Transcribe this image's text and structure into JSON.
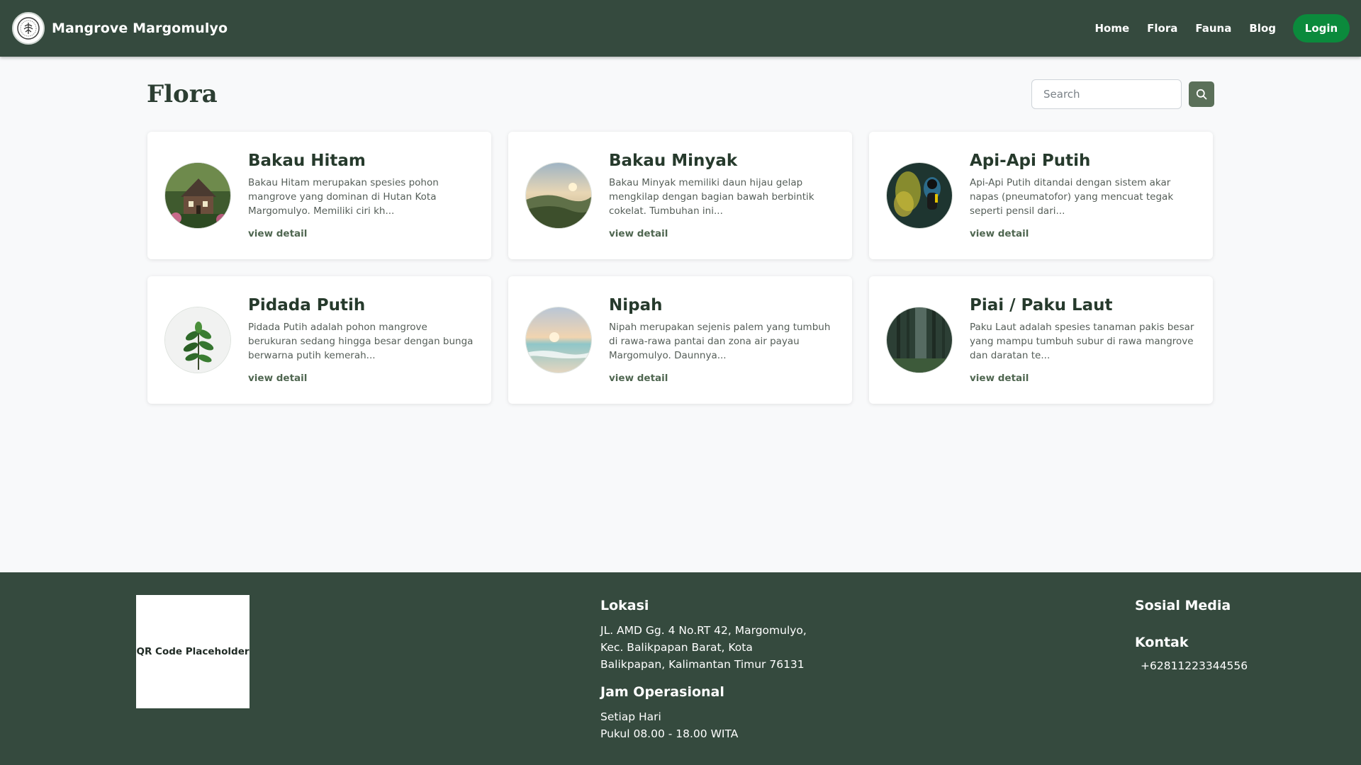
{
  "navbar": {
    "brand": "Mangrove Margomulyo",
    "links": [
      "Home",
      "Flora",
      "Fauna",
      "Blog"
    ],
    "login_label": "Login"
  },
  "page": {
    "title": "Flora",
    "search_placeholder": "Search"
  },
  "cards": [
    {
      "title": "Bakau Hitam",
      "description": "Bakau Hitam merupakan spesies pohon mangrove yang dominan di Hutan Kota Margomulyo. Memiliki ciri kh...",
      "link": "view detail",
      "image": "house-photo"
    },
    {
      "title": "Bakau Minyak",
      "description": "Bakau Minyak memiliki daun hijau gelap mengkilap dengan bagian bawah berbintik cokelat. Tumbuhan ini...",
      "link": "view detail",
      "image": "hills-photo"
    },
    {
      "title": "Api-Api Putih",
      "description": "Api-Api Putih ditandai dengan sistem akar napas (pneumatofor) yang mencuat tegak seperti pensil dari...",
      "link": "view detail",
      "image": "diver-photo"
    },
    {
      "title": "Pidada Putih",
      "description": "Pidada Putih adalah pohon mangrove berukuran sedang hingga besar dengan bunga berwarna putih kemerah...",
      "link": "view detail",
      "image": "plant-photo"
    },
    {
      "title": "Nipah",
      "description": "Nipah merupakan sejenis palem yang tumbuh di rawa-rawa pantai dan zona air payau Margomulyo. Daunnya...",
      "link": "view detail",
      "image": "beach-photo"
    },
    {
      "title": "Piai / Paku Laut",
      "description": "Paku Laut adalah spesies tanaman pakis besar yang mampu tumbuh subur di rawa mangrove dan daratan te...",
      "link": "view detail",
      "image": "forest-photo"
    }
  ],
  "footer": {
    "qr_label": "QR Code Placeholder",
    "lokasi_title": "Lokasi",
    "lokasi_lines": [
      "JL. AMD Gg. 4 No.RT 42, Margomulyo,",
      "Kec. Balikpapan Barat, Kota",
      "Balikpapan, Kalimantan Timur 76131"
    ],
    "jam_title": "Jam Operasional",
    "jam_lines": [
      "Setiap Hari",
      "Pukul 08.00 - 18.00 WITA"
    ],
    "sosial_title": "Sosial Media",
    "kontak_title": "Kontak",
    "kontak_phone": "+62811223344556"
  },
  "colors": {
    "nav_bg": "#354a3e",
    "login_bg": "#0b8a3c",
    "search_btn": "#5b7059",
    "page_bg": "#f8f9fa"
  }
}
